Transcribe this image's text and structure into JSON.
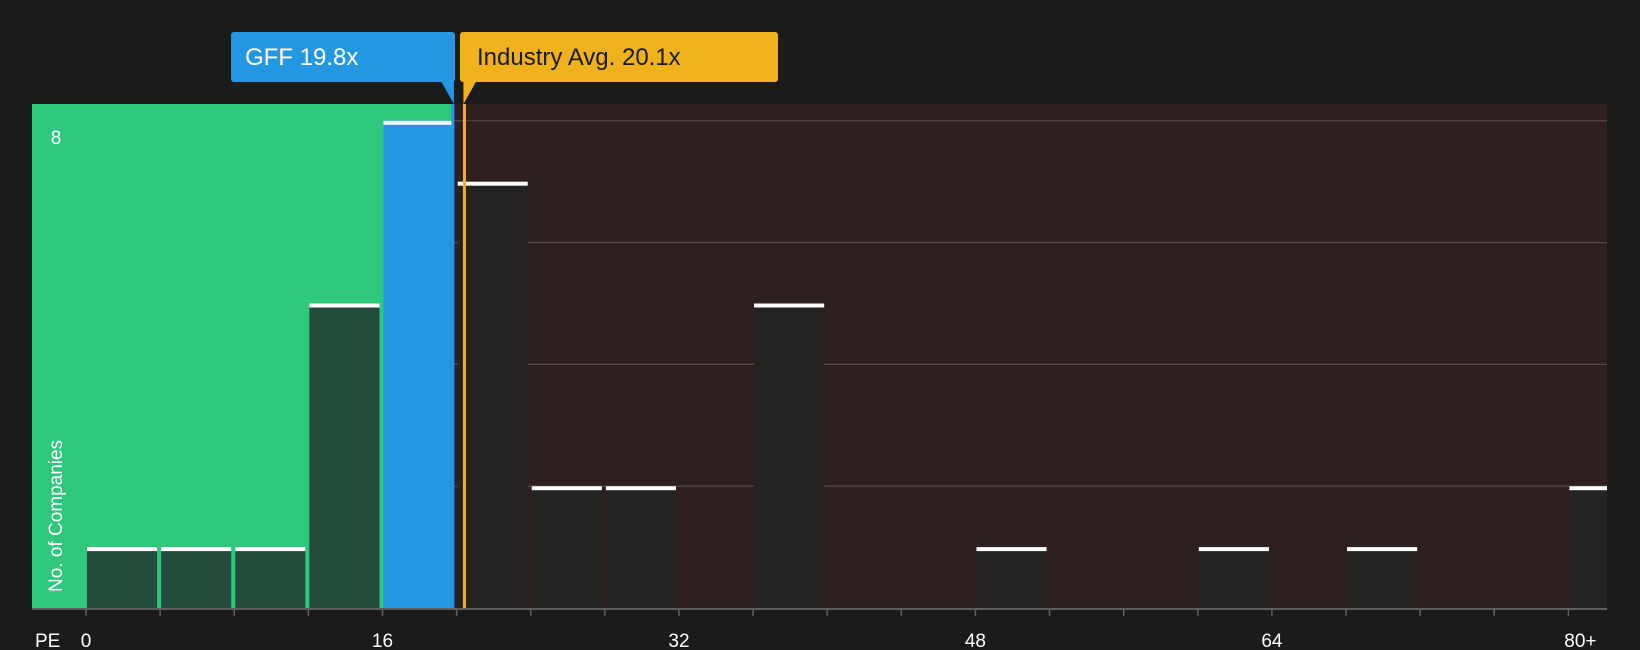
{
  "chart_data": {
    "type": "bar",
    "title": "",
    "xlabel": "PE",
    "ylabel": "No. of Companies",
    "x_ticks": [
      "0",
      "16",
      "32",
      "48",
      "64",
      "80+"
    ],
    "y_ticks": [
      "8"
    ],
    "xlim": [
      0,
      82
    ],
    "ylim": [
      0,
      8.3
    ],
    "bin_width": 4,
    "bins": [
      {
        "x_start": 0,
        "count": 1
      },
      {
        "x_start": 4,
        "count": 1
      },
      {
        "x_start": 8,
        "count": 1
      },
      {
        "x_start": 12,
        "count": 5
      },
      {
        "x_start": 16,
        "count": 8,
        "highlight": true
      },
      {
        "x_start": 20,
        "count": 7
      },
      {
        "x_start": 24,
        "count": 2
      },
      {
        "x_start": 28,
        "count": 2
      },
      {
        "x_start": 32,
        "count": 0
      },
      {
        "x_start": 36,
        "count": 5
      },
      {
        "x_start": 40,
        "count": 0
      },
      {
        "x_start": 44,
        "count": 0
      },
      {
        "x_start": 48,
        "count": 1
      },
      {
        "x_start": 52,
        "count": 0
      },
      {
        "x_start": 56,
        "count": 0
      },
      {
        "x_start": 60,
        "count": 1
      },
      {
        "x_start": 64,
        "count": 0
      },
      {
        "x_start": 68,
        "count": 1
      },
      {
        "x_start": 72,
        "count": 0
      },
      {
        "x_start": 76,
        "count": 0
      },
      {
        "x_start": 80,
        "count": 2
      }
    ],
    "markers": [
      {
        "name": "GFF",
        "label": "GFF 19.8x",
        "value": 19.8,
        "color": "#2596e2"
      },
      {
        "name": "Industry Avg.",
        "label": "Industry Avg. 20.1x",
        "value": 20.1,
        "color": "#efb21c"
      }
    ],
    "colors": {
      "undervalued_zone": "#2ec77c",
      "overvalued_zone": "#2e1f20",
      "bar_in_green": "#234d3b",
      "bar_in_dark": "#252222",
      "bar_cap": "#ffffff",
      "highlight_bar": "#2596e2",
      "gridline": "#5b4a4a",
      "axis": "#5e5e5e",
      "text": "#ffffff"
    }
  }
}
